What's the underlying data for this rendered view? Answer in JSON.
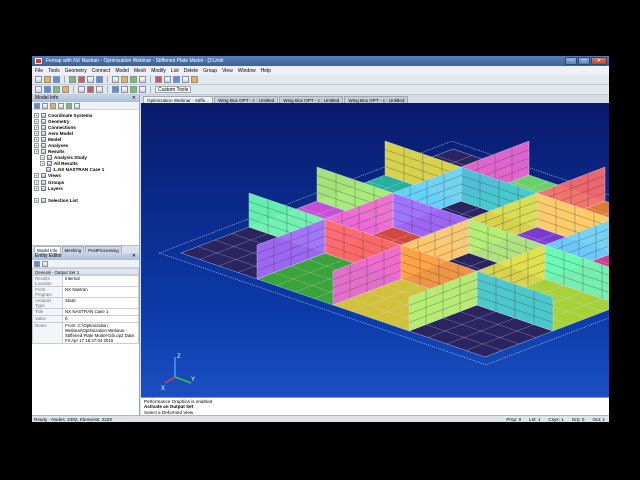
{
  "window": {
    "title": "Femap with NX Nastran - Optimization Webinar - Stiffened Plate Model - [3:Untit"
  },
  "menu": [
    "File",
    "Tools",
    "Geometry",
    "Connect",
    "Model",
    "Mesh",
    "Modify",
    "List",
    "Delete",
    "Group",
    "View",
    "Window",
    "Help"
  ],
  "toolbar": {
    "custom_tools": "Custom Tools"
  },
  "model_info": {
    "title": "Model Info",
    "tree": [
      {
        "label": "Coordinate Systems",
        "bold": true,
        "indent": 0
      },
      {
        "label": "Geometry",
        "bold": true,
        "indent": 0
      },
      {
        "label": "Connections",
        "bold": true,
        "indent": 0
      },
      {
        "label": "Aero Model",
        "bold": true,
        "indent": 0
      },
      {
        "label": "Model",
        "bold": true,
        "indent": 0
      },
      {
        "label": "Analyses",
        "bold": true,
        "indent": 0
      },
      {
        "label": "Results",
        "bold": true,
        "indent": 0
      },
      {
        "label": "Analysis Study",
        "bold": true,
        "indent": 1
      },
      {
        "label": "All Results",
        "bold": true,
        "indent": 1
      },
      {
        "label": "1..NX NASTRAN Case 1",
        "bold": true,
        "indent": 2
      },
      {
        "label": "Views",
        "bold": true,
        "indent": 0
      },
      {
        "label": "Groups",
        "bold": true,
        "indent": 0
      },
      {
        "label": "Layers",
        "bold": true,
        "indent": 0
      },
      {
        "label": "",
        "bold": false,
        "indent": 0
      },
      {
        "label": "Selection List",
        "bold": true,
        "indent": 0
      }
    ]
  },
  "bottom_tabs": [
    "Model Info",
    "Meshing",
    "PostProcessing"
  ],
  "entity_editor": {
    "title": "Entity Editor",
    "section": "General - Output Set 1",
    "rows": [
      {
        "key": "Results Location",
        "value": "Internal"
      },
      {
        "key": "From Program",
        "value": "NX Nastran"
      },
      {
        "key": "Analysis Type",
        "value": "Static"
      },
      {
        "key": "Title",
        "value": "NX NASTRAN Case 1"
      },
      {
        "key": "Value",
        "value": "0."
      },
      {
        "key": "Notes",
        "value": "From: C:\\Optimization Webinar\\Optimization Webinar - Stiffened Plate Model-Gib.op2 Date: Fri Apr 17 16:27:04 2015"
      }
    ]
  },
  "view_tabs": [
    "Optimization Webinar - Stiffe...",
    "Wing Box OPT - c : Untitled",
    "Wing Box OPT - c : Untitled",
    "Wing Box OPT - c : Untitled"
  ],
  "messages": [
    "Performance Graphics is enabled",
    "Activate an Output Set",
    "Select a Deformed View"
  ],
  "status": {
    "left": "Ready - Nodes: 2492, Elements: 2228",
    "right": [
      "Prop: 0",
      "Lst: 1",
      "Csys: 1",
      "Grp: 0",
      "Out: 1"
    ]
  },
  "triad": {
    "x": "X",
    "y": "Y",
    "z": "Z"
  },
  "scene": {
    "dark_plate_color": "#2a2460",
    "grid_line_color": "#d2d8e6",
    "base_colors": [
      "#1a8c6b",
      "#c84fd8",
      "#27b09f",
      "#4f5bd9",
      "#3aa33a",
      "#d2473e",
      "#e0a83a",
      "#6bd26b",
      "#d2c13a",
      "#4ab0e0",
      "#7b3ad2",
      "#e07a3a",
      "#3a61d2",
      "#a8d23a",
      "#d23a8f",
      "#3ad2c8"
    ],
    "wall_colors": [
      "#e6e14a",
      "#f06ad6",
      "#43c7d8",
      "#b3f07a",
      "#ff6b6b",
      "#6ad4ff",
      "#ffd36b",
      "#a66bff",
      "#6bffb0",
      "#ff9f43"
    ]
  }
}
